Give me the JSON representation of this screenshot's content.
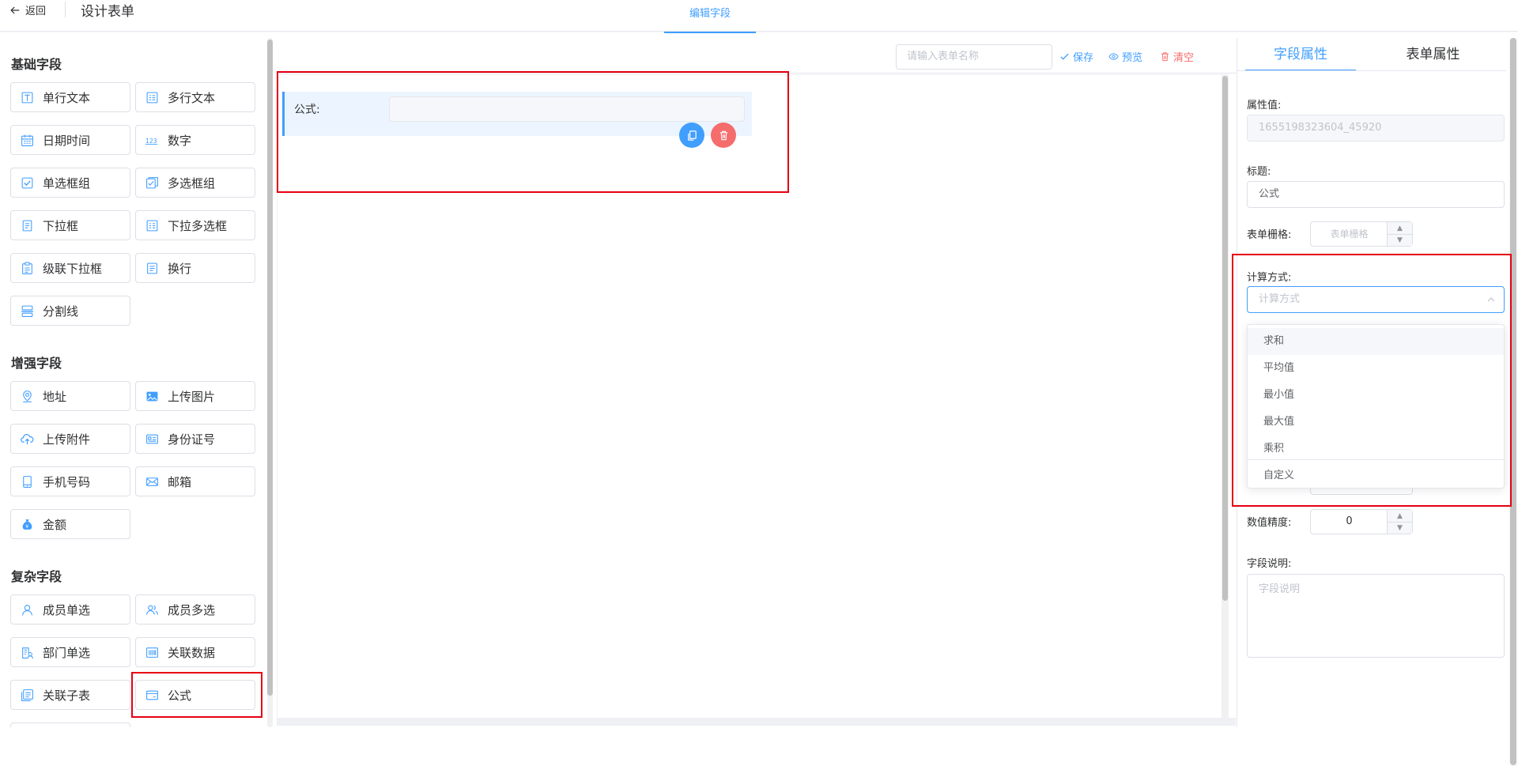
{
  "header": {
    "back_label": "返回",
    "page_title": "设计表单",
    "center_tab": "编辑字段"
  },
  "palette": {
    "basic_title": "基础字段",
    "basic": [
      {
        "label": "单行文本",
        "icon": "single-line-text-icon"
      },
      {
        "label": "多行文本",
        "icon": "multi-line-text-icon"
      },
      {
        "label": "日期时间",
        "icon": "calendar-icon"
      },
      {
        "label": "数字",
        "icon": "number-123-icon"
      },
      {
        "label": "单选框组",
        "icon": "checkbox-icon"
      },
      {
        "label": "多选框组",
        "icon": "multi-checkbox-icon"
      },
      {
        "label": "下拉框",
        "icon": "dropdown-icon"
      },
      {
        "label": "下拉多选框",
        "icon": "multi-dropdown-icon"
      },
      {
        "label": "级联下拉框",
        "icon": "cascade-dropdown-icon"
      },
      {
        "label": "换行",
        "icon": "line-break-icon"
      },
      {
        "label": "分割线",
        "icon": "divider-icon"
      }
    ],
    "enhanced_title": "增强字段",
    "enhanced": [
      {
        "label": "地址",
        "icon": "location-pin-icon"
      },
      {
        "label": "上传图片",
        "icon": "image-upload-icon"
      },
      {
        "label": "上传附件",
        "icon": "cloud-upload-icon"
      },
      {
        "label": "身份证号",
        "icon": "id-card-icon"
      },
      {
        "label": "手机号码",
        "icon": "mobile-phone-icon"
      },
      {
        "label": "邮箱",
        "icon": "mail-icon"
      },
      {
        "label": "金额",
        "icon": "money-bag-icon"
      }
    ],
    "complex_title": "复杂字段",
    "complex": [
      {
        "label": "成员单选",
        "icon": "user-icon"
      },
      {
        "label": "成员多选",
        "icon": "users-icon"
      },
      {
        "label": "部门单选",
        "icon": "department-icon"
      },
      {
        "label": "关联数据",
        "icon": "link-data-icon"
      },
      {
        "label": "关联子表",
        "icon": "sub-table-icon"
      },
      {
        "label": "公式",
        "icon": "formula-icon"
      }
    ]
  },
  "toolbar": {
    "form_name_placeholder": "请输入表单名称",
    "save_label": "保存",
    "preview_label": "预览",
    "clear_label": "清空"
  },
  "canvas": {
    "field_label": "公式:"
  },
  "props": {
    "tab_field": "字段属性",
    "tab_form": "表单属性",
    "attr_value_label": "属性值:",
    "attr_value": "1655198323604_45920",
    "title_label": "标题:",
    "title_value": "公式",
    "grid_label": "表单栅格:",
    "grid_placeholder": "表单栅格",
    "calc_label": "计算方式:",
    "calc_placeholder": "计算方式",
    "calc_options": [
      "求和",
      "平均值",
      "最小值",
      "最大值",
      "乘积",
      "自定义"
    ],
    "precision_label": "数值精度:",
    "precision_value": "0",
    "desc_label": "字段说明:",
    "desc_placeholder": "字段说明"
  },
  "colors": {
    "accent": "#409eff",
    "danger": "#f56c6c",
    "highlight": "#e60012"
  }
}
